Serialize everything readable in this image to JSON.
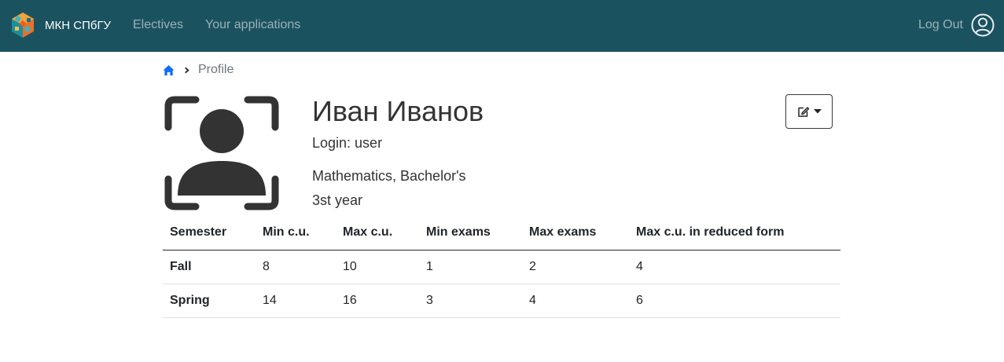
{
  "navbar": {
    "brand": "МКН СПбГУ",
    "links": [
      "Electives",
      "Your applications"
    ],
    "logout": "Log Out",
    "background": "#1b525f"
  },
  "breadcrumb": {
    "current": "Profile"
  },
  "profile": {
    "name": "Иван Иванов",
    "login": "Login: user",
    "program": "Mathematics, Bachelor's",
    "year": "3st year"
  },
  "table": {
    "headers": [
      "Semester",
      "Min c.u.",
      "Max c.u.",
      "Min exams",
      "Max exams",
      "Max c.u. in reduced form"
    ],
    "rows": [
      [
        "Fall",
        "8",
        "10",
        "1",
        "2",
        "4"
      ],
      [
        "Spring",
        "14",
        "16",
        "3",
        "4",
        "6"
      ]
    ]
  },
  "icons": {
    "home": "home-icon",
    "separator": "chevron-right-icon",
    "avatar": "person-scan-icon",
    "user": "user-circle-icon",
    "edit": "pencil-square-icon",
    "caret": "caret-down-icon"
  }
}
